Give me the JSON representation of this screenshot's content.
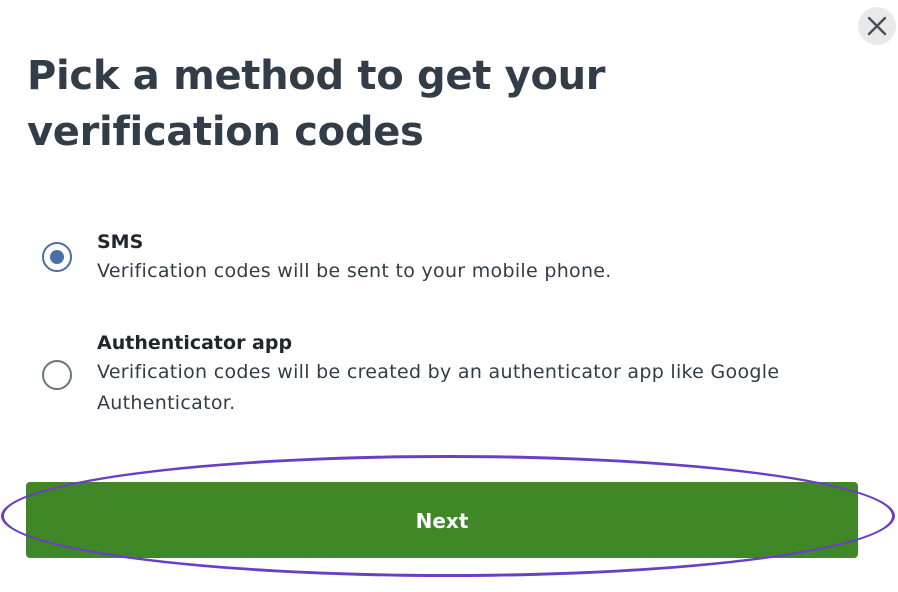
{
  "dialog": {
    "title": "Pick a method to get your verification codes",
    "close_icon": "close-icon"
  },
  "options": [
    {
      "title": "SMS",
      "description": "Verification codes will be sent to your mobile phone.",
      "selected": true
    },
    {
      "title": "Authenticator app",
      "description": "Verification codes will be created by an authenticator app like Google Authenticator.",
      "selected": false
    }
  ],
  "actions": {
    "next_label": "Next"
  },
  "colors": {
    "primary_button": "#3f8727",
    "radio_selected": "#4a6fa5",
    "title_text": "#333d47",
    "highlight_outline": "#6a3fc4"
  }
}
